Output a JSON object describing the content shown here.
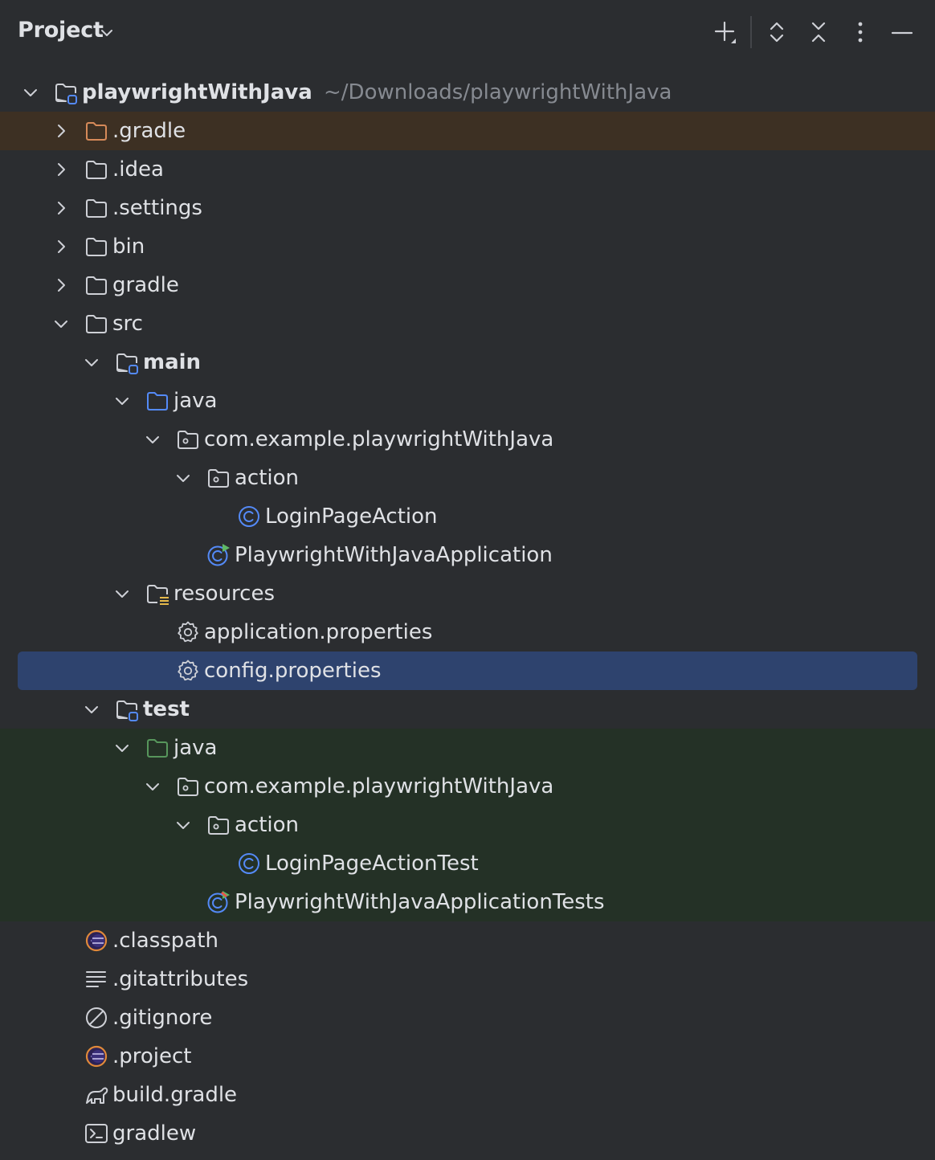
{
  "panel": {
    "title": "Project",
    "actions": [
      "add-icon",
      "expand-all-icon",
      "collapse-all-icon",
      "more-options-icon",
      "hide-panel-icon"
    ]
  },
  "tree": [
    {
      "label": "playwrightWithJava",
      "path_hint": "~/Downloads/playwrightWithJava",
      "level": 0,
      "state": "expanded",
      "icon": "module-folder-icon",
      "bold": true
    },
    {
      "label": ".gradle",
      "level": 1,
      "state": "collapsed",
      "icon": "excluded-folder-icon",
      "highlight": "excluded"
    },
    {
      "label": ".idea",
      "level": 1,
      "state": "collapsed",
      "icon": "folder-icon"
    },
    {
      "label": ".settings",
      "level": 1,
      "state": "collapsed",
      "icon": "folder-icon"
    },
    {
      "label": "bin",
      "level": 1,
      "state": "collapsed",
      "icon": "folder-icon"
    },
    {
      "label": "gradle",
      "level": 1,
      "state": "collapsed",
      "icon": "folder-icon"
    },
    {
      "label": "src",
      "level": 1,
      "state": "expanded",
      "icon": "folder-icon"
    },
    {
      "label": "main",
      "level": 2,
      "state": "expanded",
      "icon": "module-folder-icon",
      "bold": true
    },
    {
      "label": "java",
      "level": 3,
      "state": "expanded",
      "icon": "source-root-folder-icon"
    },
    {
      "label": "com.example.playwrightWithJava",
      "level": 4,
      "state": "expanded",
      "icon": "package-icon"
    },
    {
      "label": "action",
      "level": 5,
      "state": "expanded",
      "icon": "package-icon"
    },
    {
      "label": "LoginPageAction",
      "level": 6,
      "state": "leaf",
      "icon": "java-class-icon"
    },
    {
      "label": "PlaywrightWithJavaApplication",
      "level": 5,
      "state": "leaf",
      "icon": "spring-boot-class-icon"
    },
    {
      "label": "resources",
      "level": 3,
      "state": "expanded",
      "icon": "resources-folder-icon"
    },
    {
      "label": "application.properties",
      "level": 4,
      "state": "leaf",
      "icon": "properties-gear-icon"
    },
    {
      "label": "config.properties",
      "level": 4,
      "state": "leaf",
      "icon": "properties-gear-icon",
      "selected": true
    },
    {
      "label": "test",
      "level": 2,
      "state": "expanded",
      "icon": "module-folder-icon",
      "bold": true
    },
    {
      "label": "java",
      "level": 3,
      "state": "expanded",
      "icon": "test-root-folder-icon",
      "highlight": "test"
    },
    {
      "label": "com.example.playwrightWithJava",
      "level": 4,
      "state": "expanded",
      "icon": "package-icon",
      "highlight": "test"
    },
    {
      "label": "action",
      "level": 5,
      "state": "expanded",
      "icon": "package-icon",
      "highlight": "test"
    },
    {
      "label": "LoginPageActionTest",
      "level": 6,
      "state": "leaf",
      "icon": "java-class-icon",
      "highlight": "test"
    },
    {
      "label": "PlaywrightWithJavaApplicationTests",
      "level": 5,
      "state": "leaf",
      "icon": "spring-test-class-icon",
      "highlight": "test"
    },
    {
      "label": ".classpath",
      "level": 1,
      "state": "leaf",
      "icon": "eclipse-file-icon"
    },
    {
      "label": ".gitattributes",
      "level": 1,
      "state": "leaf",
      "icon": "text-lines-icon"
    },
    {
      "label": ".gitignore",
      "level": 1,
      "state": "leaf",
      "icon": "ignore-icon"
    },
    {
      "label": ".project",
      "level": 1,
      "state": "leaf",
      "icon": "eclipse-file-icon"
    },
    {
      "label": "build.gradle",
      "level": 1,
      "state": "leaf",
      "icon": "gradle-elephant-icon"
    },
    {
      "label": "gradlew",
      "level": 1,
      "state": "leaf",
      "icon": "terminal-script-icon"
    }
  ],
  "colors": {
    "background": "#2b2d30",
    "text": "#dfe1e5",
    "hint": "#868a91",
    "selection": "#2e436e",
    "excluded_row": "#3d3023",
    "test_row": "#243126",
    "folder_stroke": "#ced0d6",
    "excluded_folder": "#d68a59",
    "source_folder": "#548af7",
    "test_folder": "#57965c",
    "class_blue": "#548af7"
  }
}
